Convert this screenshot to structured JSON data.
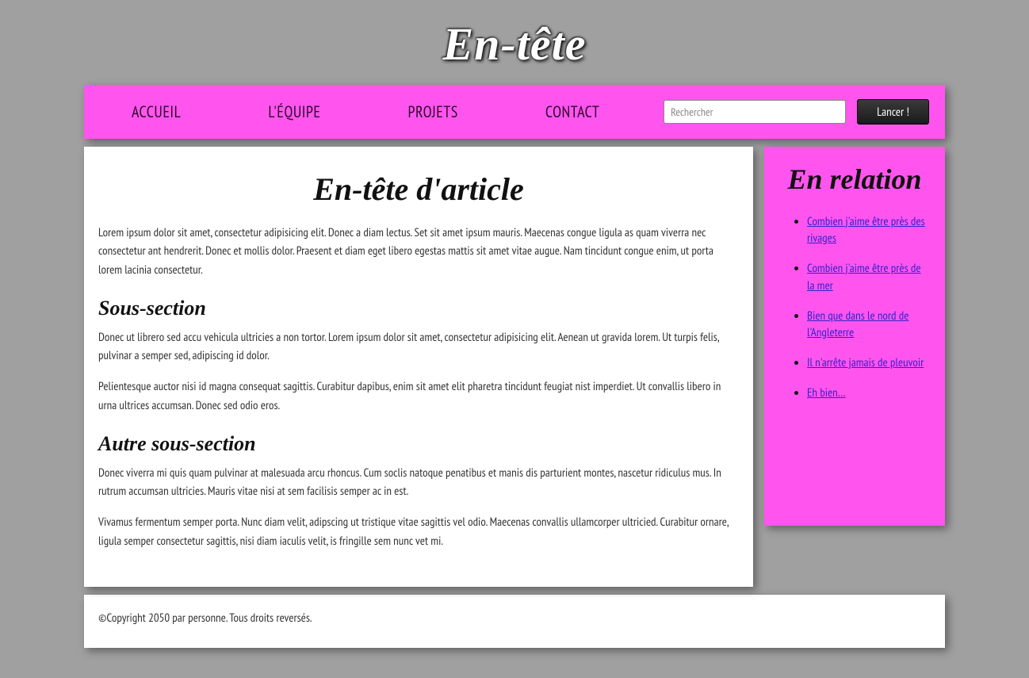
{
  "header": {
    "title": "En-tête"
  },
  "nav": {
    "items": [
      {
        "label": "Accueil"
      },
      {
        "label": "L'équipe"
      },
      {
        "label": "Projets"
      },
      {
        "label": "Contact"
      }
    ],
    "search": {
      "placeholder": "Rechercher",
      "value": ""
    },
    "submit_label": "Lancer !"
  },
  "article": {
    "title": "En-tête d'article",
    "intro": "Lorem ipsum dolor sit amet, consectetur adipisicing elit. Donec a diam lectus. Set sit amet ipsum mauris. Maecenas congue ligula as quam viverra nec consectetur ant hendrerit. Donec et mollis dolor. Praesent et diam eget libero egestas mattis sit amet vitae augue. Nam tincidunt congue enim, ut porta lorem lacinia consectetur.",
    "sections": [
      {
        "heading": "Sous-section",
        "paragraphs": [
          "Donec ut librero sed accu vehicula ultricies a non tortor. Lorem ipsum dolor sit amet, consectetur adipisicing elit. Aenean ut gravida lorem. Ut turpis felis, pulvinar a semper sed, adipiscing id dolor.",
          "Pelientesque auctor nisi id magna consequat sagittis. Curabitur dapibus, enim sit amet elit pharetra tincidunt feugiat nist imperdiet. Ut convallis libero in urna ultrices accumsan. Donec sed odio eros."
        ]
      },
      {
        "heading": "Autre sous-section",
        "paragraphs": [
          "Donec viverra mi quis quam pulvinar at malesuada arcu rhoncus. Cum soclis natoque penatibus et manis dis parturient montes, nascetur ridiculus mus. In rutrum accumsan ultricies. Mauris vitae nisi at sem facilisis semper ac in est.",
          "Vivamus fermentum semper porta. Nunc diam velit, adipscing ut tristique vitae sagittis vel odio. Maecenas convallis ullamcorper ultricied. Curabitur ornare, ligula semper consectetur sagittis, nisi diam iaculis velit, is fringille sem nunc vet mi."
        ]
      }
    ]
  },
  "sidebar": {
    "title": "En relation",
    "links": [
      {
        "label": "Combien j'aime être près des rivages"
      },
      {
        "label": "Combien j'aime être près de la mer"
      },
      {
        "label": "Bien que dans le nord de l'Angleterre"
      },
      {
        "label": "Il n'arrête jamais de pleuvoir"
      },
      {
        "label": "Eh bien…"
      }
    ]
  },
  "footer": {
    "text": "©Copyright 2050 par personne. Tous droits reversés."
  }
}
